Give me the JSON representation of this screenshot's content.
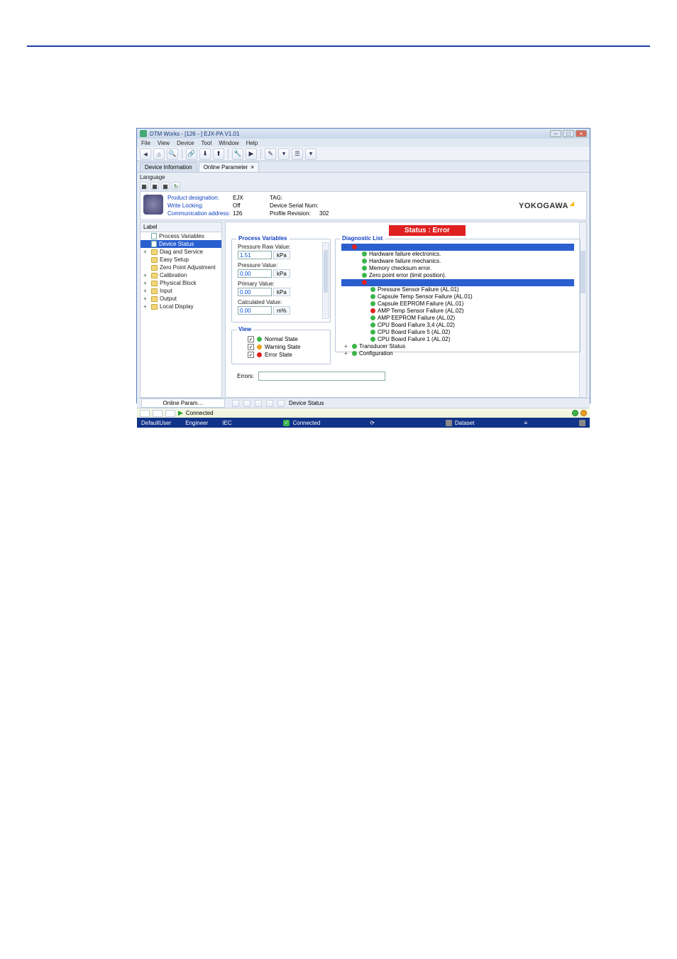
{
  "window": {
    "title": "DTM Works - [126 - ] EJX-PA V1.01"
  },
  "menu": {
    "file": "File",
    "view": "View",
    "device": "Device",
    "tool": "Tool",
    "window": "Window",
    "help": "Help"
  },
  "tabs": {
    "device_info": "Device Information",
    "online_param": "Online Parameter"
  },
  "lang_label": "Language",
  "header": {
    "product_designation_label": "Product designation:",
    "product_designation_value": "EJX",
    "write_locking_label": "Write Locking:",
    "write_locking_value": "Off",
    "comm_addr_label": "Communication address:",
    "comm_addr_value": "126",
    "tag_label": "TAG:",
    "tag_value": "",
    "serial_label": "Device Serial Num:",
    "serial_value": "",
    "profile_label": "Profile Revision:",
    "profile_value": "302"
  },
  "logo": "YOKOGAWA",
  "tree_head": "Label",
  "tree": [
    {
      "label": "Process Variables",
      "type": "doc",
      "exp": ""
    },
    {
      "label": "Device Status",
      "type": "doc",
      "exp": "",
      "sel": true
    },
    {
      "label": "Diag and Service",
      "type": "fld",
      "exp": "+"
    },
    {
      "label": "Easy Setup",
      "type": "fld",
      "exp": ""
    },
    {
      "label": "Zero Point Adjustment",
      "type": "fld",
      "exp": ""
    },
    {
      "label": "Calibration",
      "type": "fld",
      "exp": "+"
    },
    {
      "label": "Physical Block",
      "type": "fld",
      "exp": "+"
    },
    {
      "label": "Input",
      "type": "fld",
      "exp": "+"
    },
    {
      "label": "Output",
      "type": "fld",
      "exp": "+"
    },
    {
      "label": "Local Display",
      "type": "fld",
      "exp": "+"
    }
  ],
  "status_banner": "Status : Error",
  "process_variables": {
    "legend": "Process Variables",
    "fields": [
      {
        "label": "Pressure Raw Value:",
        "value": "1.51",
        "unit": "kPa"
      },
      {
        "label": "Pressure Value:",
        "value": "0.00",
        "unit": "kPa"
      },
      {
        "label": "Primary Value:",
        "value": "0.00",
        "unit": "kPa"
      },
      {
        "label": "Calculated Value:",
        "value": "0.00",
        "unit": "m%"
      }
    ]
  },
  "view_legend": "View",
  "view_states": [
    {
      "label": "Normal State",
      "color": "green"
    },
    {
      "label": "Warning State",
      "color": "orange"
    },
    {
      "label": "Error State",
      "color": "red"
    }
  ],
  "errors_label": "Errors:",
  "diagnostic": {
    "legend": "Diagnostic List",
    "items": [
      {
        "level": 1,
        "exp": "-",
        "dot": "red",
        "label": "",
        "sel": true
      },
      {
        "level": 2,
        "exp": "",
        "dot": "green",
        "label": "Hardware failure electronics."
      },
      {
        "level": 2,
        "exp": "",
        "dot": "green",
        "label": "Hardware failure mechanics."
      },
      {
        "level": 2,
        "exp": "",
        "dot": "green",
        "label": "Memory checksum error."
      },
      {
        "level": 2,
        "exp": "",
        "dot": "green",
        "label": "Zero point error (limit position)."
      },
      {
        "level": 2,
        "exp": "-",
        "dot": "red",
        "label": "",
        "sel": true
      },
      {
        "level": 3,
        "exp": "",
        "dot": "green",
        "label": "Pressure Sensor Failure (AL.01)"
      },
      {
        "level": 3,
        "exp": "",
        "dot": "green",
        "label": "Capsule Temp Sensor Failure (AL.01)"
      },
      {
        "level": 3,
        "exp": "",
        "dot": "green",
        "label": "Capsule EEPROM Failure (AL.01)"
      },
      {
        "level": 3,
        "exp": "",
        "dot": "red",
        "label": "AMP Temp Sensor Failure (AL.02)"
      },
      {
        "level": 3,
        "exp": "",
        "dot": "green",
        "label": "AMP EEPROM Failure (AL.02)"
      },
      {
        "level": 3,
        "exp": "",
        "dot": "green",
        "label": "CPU Board Failure 3,4 (AL.02)"
      },
      {
        "level": 3,
        "exp": "",
        "dot": "green",
        "label": "CPU Board Failure 5 (AL.02)"
      },
      {
        "level": 3,
        "exp": "",
        "dot": "green",
        "label": "CPU Board Failure 1 (AL.02)"
      },
      {
        "level": 1,
        "exp": "+",
        "dot": "green",
        "label": "Transducer Status"
      },
      {
        "level": 1,
        "exp": "+",
        "dot": "green",
        "label": "Configuration"
      }
    ]
  },
  "bottom_tabs": {
    "left": "Online Param…",
    "right": "Device Status"
  },
  "connbar": {
    "status": "Connected"
  },
  "statusbar": {
    "user": "DefaultUser",
    "role": "Engineer",
    "iec": "IEC",
    "connected": "Connected",
    "dataset": "Dataset"
  }
}
